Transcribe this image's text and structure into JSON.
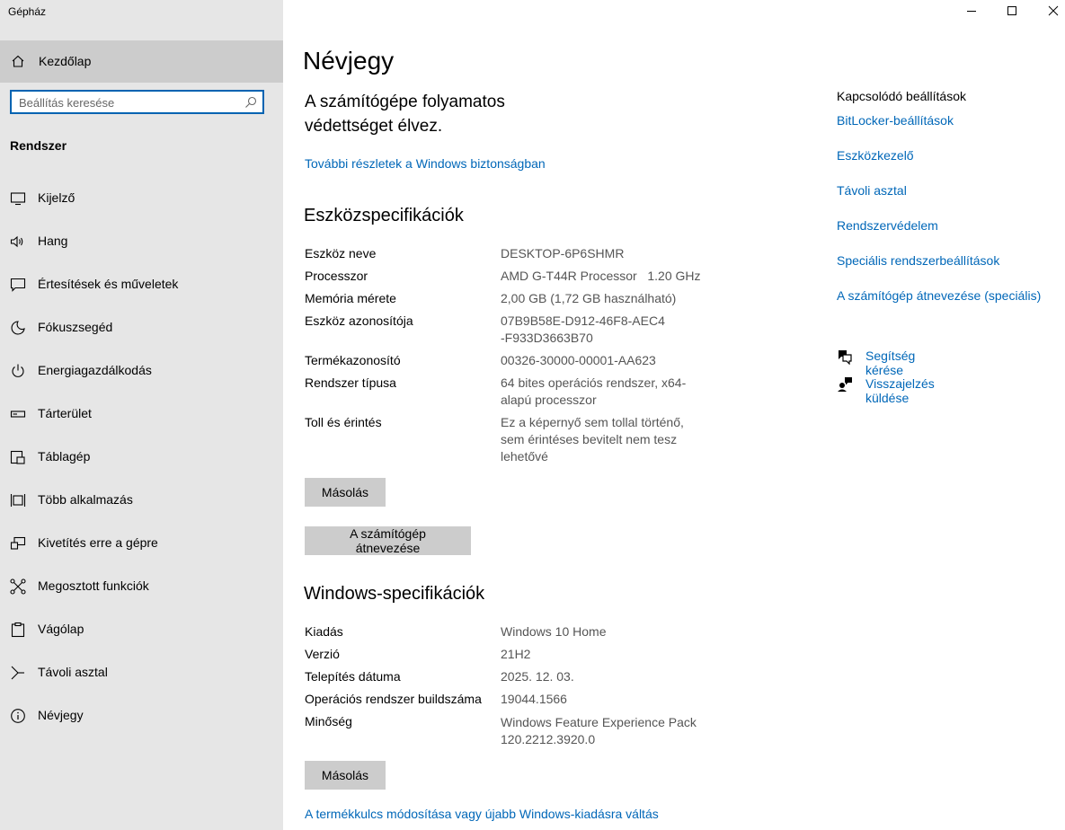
{
  "window": {
    "title": "Gépház"
  },
  "sidebar": {
    "home_label": "Kezdőlap",
    "search_placeholder": "Beállítás keresése",
    "section": "Rendszer",
    "items": [
      {
        "label": "Kijelző",
        "icon": "display-icon"
      },
      {
        "label": "Hang",
        "icon": "speaker-icon"
      },
      {
        "label": "Értesítések és műveletek",
        "icon": "notification-icon"
      },
      {
        "label": "Fókuszsegéd",
        "icon": "moon-icon"
      },
      {
        "label": "Energiagazdálkodás",
        "icon": "power-icon"
      },
      {
        "label": "Tárterület",
        "icon": "storage-icon"
      },
      {
        "label": "Táblagép",
        "icon": "tablet-icon"
      },
      {
        "label": "Több alkalmazás",
        "icon": "multitasking-icon"
      },
      {
        "label": "Kivetítés erre a gépre",
        "icon": "project-icon"
      },
      {
        "label": "Megosztott funkciók",
        "icon": "shared-icon"
      },
      {
        "label": "Vágólap",
        "icon": "clipboard-icon"
      },
      {
        "label": "Távoli asztal",
        "icon": "remote-desktop-icon"
      },
      {
        "label": "Névjegy",
        "icon": "info-icon"
      }
    ]
  },
  "main": {
    "title": "Névjegy",
    "protection_text": "A számítógépe folyamatos védettséget élvez.",
    "security_link": "További részletek a Windows biztonságban",
    "device_specs": {
      "heading": "Eszközspecifikációk",
      "rows": [
        {
          "label": "Eszköz neve",
          "value": "DESKTOP-6P6SHMR"
        },
        {
          "label": "Processzor",
          "value": "AMD G-T44R Processor   1.20 GHz"
        },
        {
          "label": "Memória mérete",
          "value": "2,00 GB (1,72 GB használható)"
        },
        {
          "label": "Eszköz azonosítója",
          "value": "07B9B58E-D912-46F8-AEC4-F933D3663B70"
        },
        {
          "label": "Termékazonosító",
          "value": "00326-30000-00001-AA623"
        },
        {
          "label": "Rendszer típusa",
          "value": "64 bites operációs rendszer, x64-alapú processzor"
        },
        {
          "label": "Toll és érintés",
          "value": "Ez a képernyő sem tollal történő, sem érintéses bevitelt nem tesz lehetővé"
        }
      ],
      "copy_button": "Másolás",
      "rename_button": "A számítógép átnevezése"
    },
    "windows_specs": {
      "heading": "Windows-specifikációk",
      "rows": [
        {
          "label": "Kiadás",
          "value": "Windows 10 Home"
        },
        {
          "label": "Verzió",
          "value": "21H2"
        },
        {
          "label": "Telepítés dátuma",
          "value": "2025. 12. 03."
        },
        {
          "label": "Operációs rendszer buildszáma",
          "value": "19044.1566"
        },
        {
          "label": "Minőség",
          "value": "Windows Feature Experience Pack 120.2212.3920.0"
        }
      ],
      "copy_button": "Másolás"
    },
    "product_key_link": "A termékkulcs módosítása vagy újabb Windows-kiadásra váltás"
  },
  "related": {
    "heading": "Kapcsolódó beállítások",
    "links": [
      "BitLocker-beállítások",
      "Eszközkezelő",
      "Távoli asztal",
      "Rendszervédelem",
      "Speciális rendszerbeállítások",
      "A számítógép átnevezése (speciális)"
    ],
    "help": [
      {
        "label": "Segítség kérése",
        "icon": "help-chat-icon"
      },
      {
        "label": "Visszajelzés küldése",
        "icon": "feedback-icon"
      }
    ]
  }
}
